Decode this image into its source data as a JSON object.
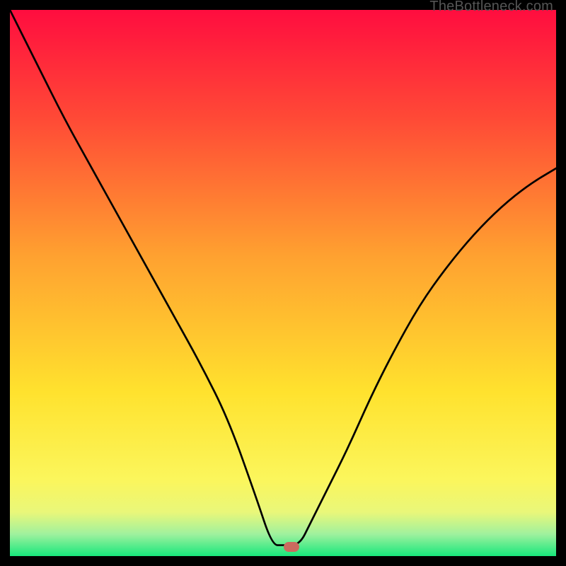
{
  "watermark": "TheBottleneck.com",
  "marker": {
    "x_pct": 51.5,
    "y_pct": 98.3
  },
  "chart_data": {
    "type": "line",
    "title": "",
    "xlabel": "",
    "ylabel": "",
    "xlim": [
      0,
      100
    ],
    "ylim": [
      0,
      100
    ],
    "series": [
      {
        "name": "bottleneck-curve",
        "x": [
          0,
          5,
          10,
          15,
          20,
          25,
          30,
          35,
          40,
          45,
          48,
          50,
          53,
          55,
          58,
          62,
          66,
          70,
          75,
          80,
          85,
          90,
          95,
          100
        ],
        "y": [
          100,
          90,
          80,
          71,
          62,
          53,
          44,
          35,
          25,
          11,
          2,
          2,
          2,
          6,
          12,
          20,
          29,
          37,
          46,
          53,
          59,
          64,
          68,
          71
        ]
      }
    ],
    "gradient_stops": [
      {
        "pct": 0,
        "color": "#ff0d3f"
      },
      {
        "pct": 20,
        "color": "#ff4a36"
      },
      {
        "pct": 45,
        "color": "#ffa130"
      },
      {
        "pct": 70,
        "color": "#ffe22e"
      },
      {
        "pct": 86,
        "color": "#fbf65c"
      },
      {
        "pct": 92,
        "color": "#e9f77a"
      },
      {
        "pct": 96,
        "color": "#9ff19e"
      },
      {
        "pct": 100,
        "color": "#17e77c"
      }
    ]
  }
}
